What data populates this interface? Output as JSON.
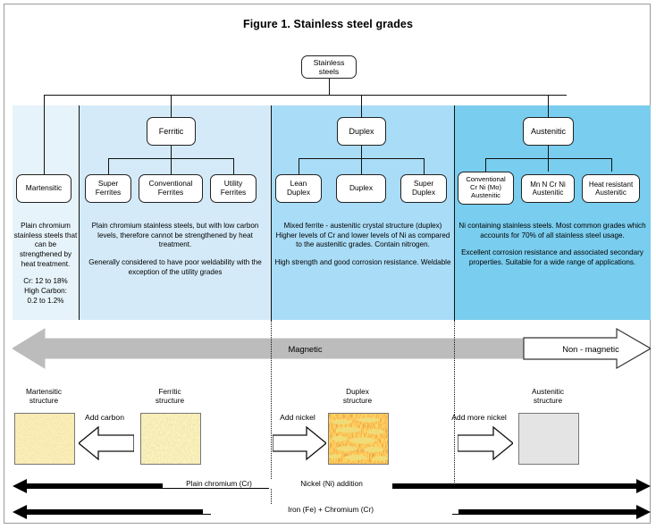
{
  "figure": {
    "title": "Figure 1. Stainless steel grades"
  },
  "tree": {
    "root": "Stainless steels",
    "level2": [
      {
        "label": "Ferritic"
      },
      {
        "label": "Duplex"
      },
      {
        "label": "Austenitic"
      }
    ],
    "level3": [
      {
        "label": "Martensitic"
      },
      {
        "label": "Super\nFerrites"
      },
      {
        "label": "Conventional\nFerrites"
      },
      {
        "label": "Utility\nFerrites"
      },
      {
        "label": "Lean\nDuplex"
      },
      {
        "label": "Duplex"
      },
      {
        "label": "Super\nDuplex"
      },
      {
        "label": "Conventional\nCr Ni (Mo)\nAustenitic"
      },
      {
        "label": "Mn N Cr Ni\nAustenitic"
      },
      {
        "label": "Heat resistant\nAustenitic"
      }
    ]
  },
  "descriptions": {
    "martensitic": {
      "p1": "Plain chromium stainless steels that can be strengthened by heat treatment.",
      "p2": "Cr: 12 to 18%",
      "p3": "High Carbon:",
      "p4": "0.2 to 1.2%"
    },
    "ferritic": {
      "p1": "Plain chromium stainless steels, but with low carbon levels, therefore cannot be strengthened by heat treatment.",
      "p2": "Generally considered to have poor weldability with the exception of the utility grades"
    },
    "duplex": {
      "p1": "Mixed ferrite - austenitic crystal structure (duplex) Higher levels of Cr and lower levels of Ni as compared to the austenitic grades. Contain nitrogen.",
      "p2": "High strength and good corrosion resistance. Weldable"
    },
    "austenitic": {
      "p1": "Ni containing stainless steels. Most common grades which accounts for 70% of all stainless steel usage.",
      "p2": "Excellent corrosion resistance and associated secondary properties. Suitable for a wide range of applications."
    }
  },
  "magnetism": {
    "magnetic_label": "Magnetic",
    "nonmagnetic_label": "Non - magnetic"
  },
  "structures": [
    {
      "name": "Martensitic\nstructure"
    },
    {
      "name": "Ferritic\nstructure"
    },
    {
      "name": "Duplex\nstructure"
    },
    {
      "name": "Austenitic\nstructure"
    }
  ],
  "transitions": [
    {
      "label": "Add carbon"
    },
    {
      "label": "Add nickel"
    },
    {
      "label": "Add more nickel"
    }
  ],
  "composition": {
    "chromium": "Plain chromium (Cr)",
    "nickel": "Nickel (Ni) addition",
    "iron_chromium": "Iron (Fe) + Chromium (Cr)"
  },
  "colors": {
    "band_martensitic": "#e6f3fa",
    "band_ferritic": "#d4eaf8",
    "band_duplex": "#a9dcf6",
    "band_austenitic": "#79cdee",
    "magnetic_fill": "#bcbcbc"
  }
}
